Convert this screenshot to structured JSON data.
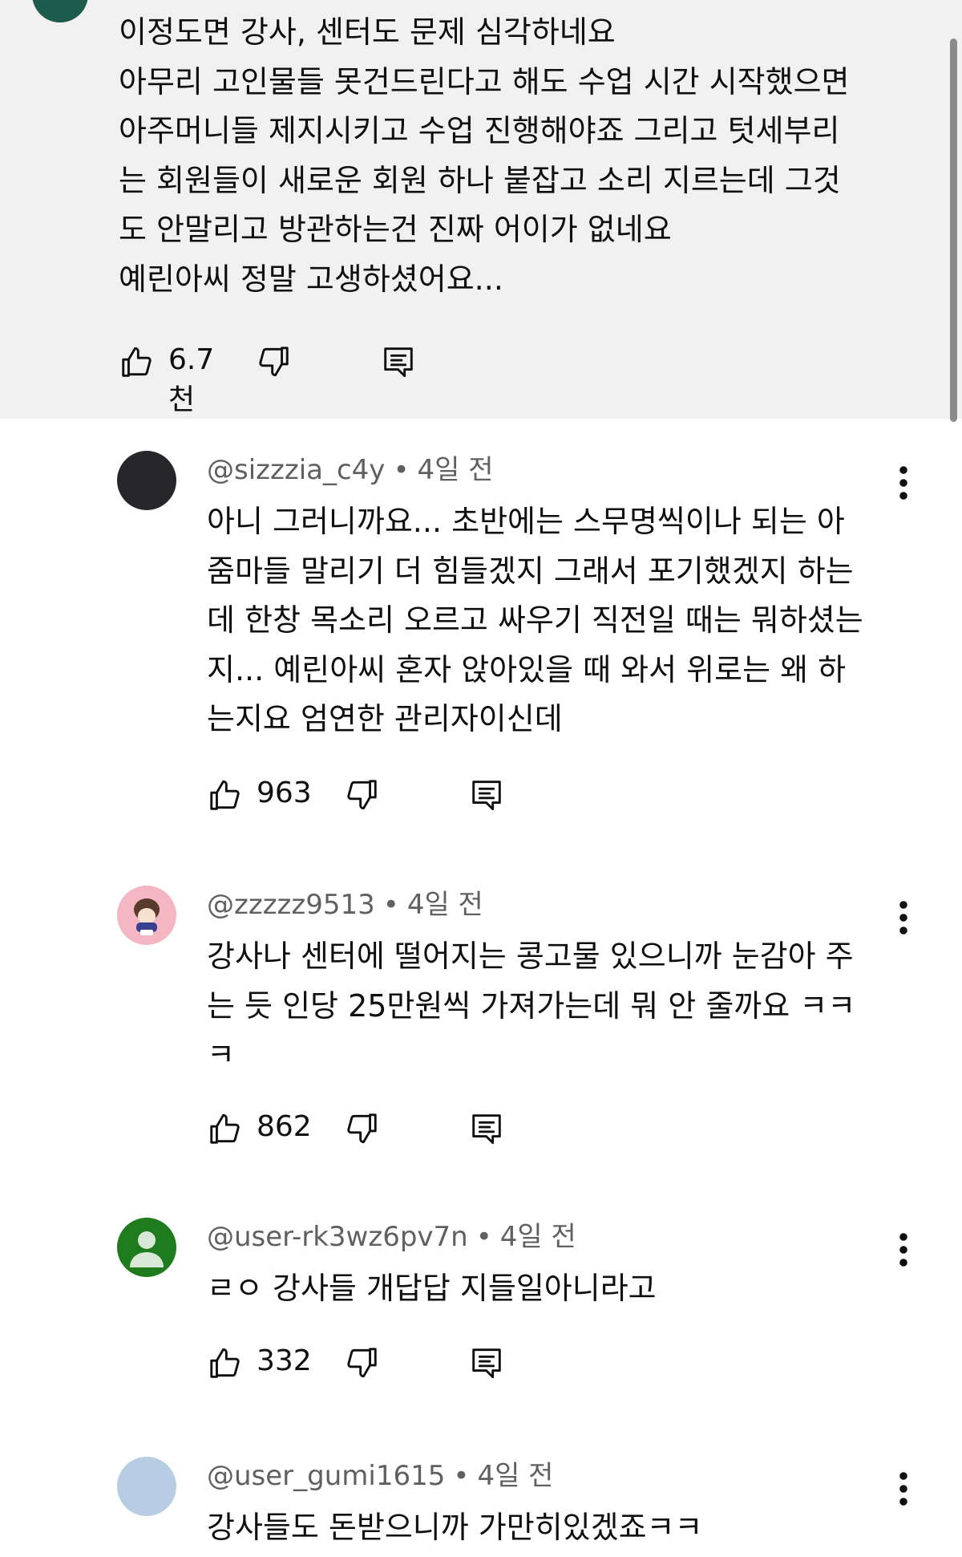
{
  "op_comment": {
    "text": "이정도면 강사, 센터도 문제 심각하네요\n아무리 고인물들 못건드린다고 해도 수업 시간 시작했으면\n아주머니들 제지시키고 수업 진행해야죠 그리고 텃세부리\n는 회원들이 새로운 회원 하나 붙잡고 소리 지르는데 그것\n도 안말리고 방관하는건 진짜 어이가 없네요\n예린아씨 정말 고생하셨어요...",
    "likes": "6.7천",
    "avatar_color": "#1f5b4c"
  },
  "replies": [
    {
      "author": "@sizzzia_c4y",
      "separator": "•",
      "time": "4일 전",
      "text": "아니 그러니까요... 초반에는 스무명씩이나 되는 아\n줌마들 말리기 더 힘들겠지 그래서 포기했겠지 하는\n데 한창 목소리 오르고 싸우기 직전일 때는 뭐하셨는\n지... 예린아씨 혼자 앉아있을 때 와서 위로는 왜 하\n는지요 엄연한 관리자이신데",
      "likes": "963",
      "avatar_color": "#26262b"
    },
    {
      "author": "@zzzzz9513",
      "separator": "•",
      "time": "4일 전",
      "text": "강사나 센터에 떨어지는 콩고물 있으니까 눈감아 주\n는 듯 인당 25만원씩 가져가는데 뭐 안 줄까요 ㅋㅋ\nㅋ",
      "likes": "862",
      "avatar_color": "#f4b6c2"
    },
    {
      "author": "@user-rk3wz6pv7n",
      "separator": "•",
      "time": "4일 전",
      "text": "ㄹㅇ 강사들 개답답 지들일아니라고",
      "likes": "332",
      "avatar_color": "#1e7b1e"
    },
    {
      "author": "@user_gumi1615",
      "separator": "•",
      "time": "4일 전",
      "text": "강사들도 돈받으니까 가만히있겠죠ㅋㅋ",
      "avatar_color": "#b8cde3"
    }
  ],
  "icons": {
    "like": "thumbs-up-icon",
    "dislike": "thumbs-down-icon",
    "reply": "comment-icon",
    "more": "more-vertical-icon"
  }
}
